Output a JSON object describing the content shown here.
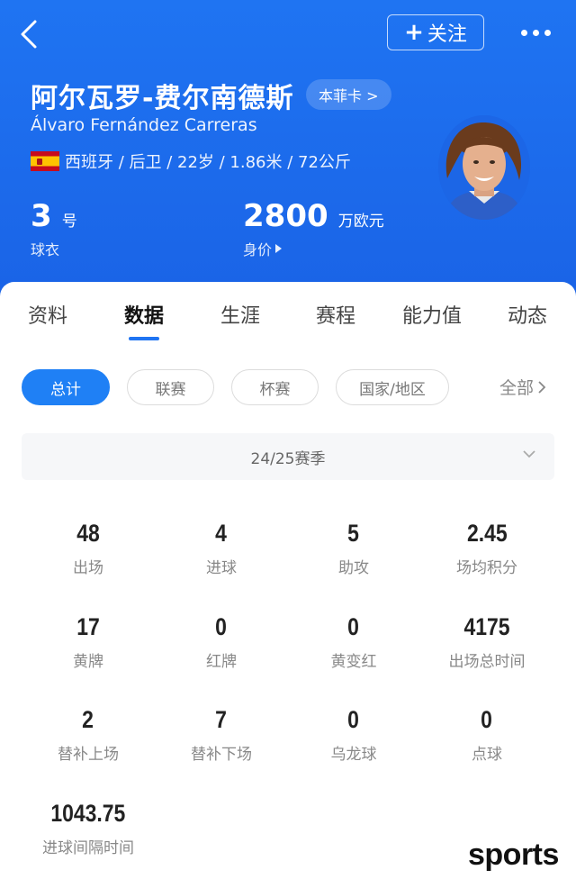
{
  "header": {
    "follow_label": "关注",
    "name_cn": "阿尔瓦罗-费尔南德斯",
    "card_chip": "本菲卡 >",
    "name_en": "Álvaro Fernández Carreras",
    "info_text": "西班牙 / 后卫 / 22岁 / 1.86米 / 72公斤",
    "jersey_number": "3",
    "jersey_unit": "号",
    "jersey_label": "球衣",
    "market_value": "2800",
    "market_value_unit": "万欧元",
    "market_value_label": "身价"
  },
  "tabs": [
    {
      "label": "资料"
    },
    {
      "label": "数据",
      "active": true
    },
    {
      "label": "生涯"
    },
    {
      "label": "赛程"
    },
    {
      "label": "能力值"
    },
    {
      "label": "动态"
    }
  ],
  "filters": [
    {
      "label": "总计",
      "active": true
    },
    {
      "label": "联赛"
    },
    {
      "label": "杯赛"
    },
    {
      "label": "国家/地区"
    }
  ],
  "all_label": "全部",
  "season": "24/25赛季",
  "stats": [
    {
      "value": "48",
      "label": "出场"
    },
    {
      "value": "4",
      "label": "进球"
    },
    {
      "value": "5",
      "label": "助攻"
    },
    {
      "value": "2.45",
      "label": "场均积分"
    },
    {
      "value": "17",
      "label": "黄牌"
    },
    {
      "value": "0",
      "label": "红牌"
    },
    {
      "value": "0",
      "label": "黄变红"
    },
    {
      "value": "4175",
      "label": "出场总时间"
    },
    {
      "value": "2",
      "label": "替补上场"
    },
    {
      "value": "7",
      "label": "替补下场"
    },
    {
      "value": "0",
      "label": "乌龙球"
    },
    {
      "value": "0",
      "label": "点球"
    },
    {
      "value": "1043.75",
      "label": "进球间隔时间"
    }
  ],
  "watermark": "sports",
  "colors": {
    "primary": "#1f74f2",
    "chip_active": "#1f80f5"
  }
}
